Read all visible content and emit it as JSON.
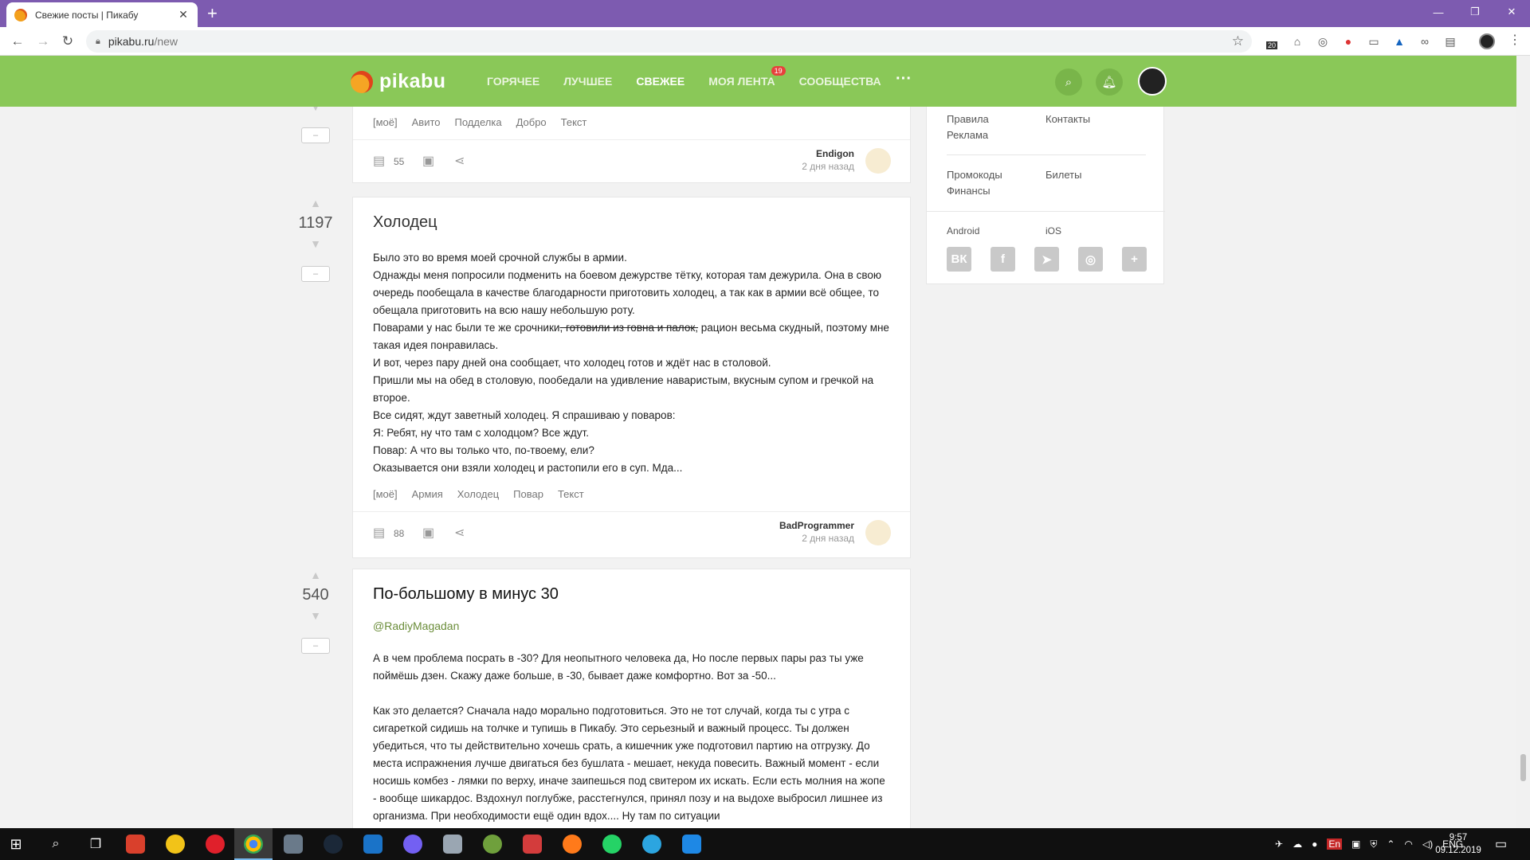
{
  "browser": {
    "tab_title": "Свежие посты | Пикабу",
    "url_host": "pikabu.ru",
    "url_path": "/new",
    "extension_badge": "20"
  },
  "header": {
    "logo": "pikabu",
    "nav": [
      {
        "label": "ГОРЯЧЕЕ",
        "active": false
      },
      {
        "label": "ЛУЧШЕЕ",
        "active": false
      },
      {
        "label": "СВЕЖЕЕ",
        "active": true
      },
      {
        "label": "МОЯ ЛЕНТА",
        "active": false,
        "badge": "19"
      },
      {
        "label": "СООБЩЕСТВА",
        "active": false
      }
    ],
    "more": "···"
  },
  "stories": [
    {
      "tags": [
        "[моё]",
        "Авито",
        "Подделка",
        "Добро",
        "Текст"
      ],
      "comments": "55",
      "author": "Endigon",
      "time": "2 дня назад",
      "minus": "–"
    },
    {
      "rating": "1197",
      "title": "Холодец",
      "lines": [
        "Было это во время моей срочной службы в армии.",
        "Однажды меня попросили подменить на боевом дежурстве тётку, которая там дежурила. Она в свою очередь пообещала в качестве благодарности приготовить холодец, а так как в армии всё общее, то обещала приготовить на всю нашу небольшую роту.",
        "И вот, через пару дней она сообщает, что холодец готов и ждёт нас в столовой.",
        "Пришли мы на обед в столовую, пообедали на удивление наваристым, вкусным супом и гречкой на второе.",
        "Все сидят, ждут заветный холодец. Я спрашиваю у поваров:",
        "Я: Ребят, ну что там с холодцом? Все ждут.",
        "Повар: А что вы только что, по-твоему, ели?",
        "Оказывается они взяли холодец и растопили его в суп. Мда..."
      ],
      "cooks_line": {
        "before": "Поварами у нас были те же срочники",
        "struck": ", готовили из говна и палок,",
        "after": " рацион весьма скудный, поэтому мне такая идея понравилась."
      },
      "tags": [
        "[моё]",
        "Армия",
        "Холодец",
        "Повар",
        "Текст"
      ],
      "comments": "88",
      "author": "BadProgrammer",
      "time": "2 дня назад",
      "minus": "–"
    },
    {
      "rating": "540",
      "title": "По-большому в минус 30",
      "author_link": "@RadiyMagadan",
      "paragraphs": [
        "А в чем проблема посрать в -30? Для неопытного человека да, Но после первых пары раз ты уже поймёшь дзен. Скажу даже больше, в -30, бывает даже комфортно. Вот за -50...",
        "Как это делается? Сначала надо морально подготовиться. Это не тот случай, когда ты с утра с сигареткой сидишь на толчке и тупишь в Пикабу. Это серьезный и важный процесс. Ты должен убедиться, что ты действительно хочешь срать, а кишечник уже подготовил партию на отгрузку. До места испражнения лучше двигаться без бушлата - мешает, некуда повесить. Важный момент - если носишь комбез - лямки по верху, иначе заипешься под свитером их искать. Если есть молния на жопе - вообще шикардос. Вздохнул поглубже, расстегнулся, принял позу и на выдохе выбросил лишнее из организма. При необходимости ещё один вдох.... Ну там по ситуации"
      ],
      "minus": "–"
    }
  ],
  "sidebar": {
    "links_top": [
      "Правила",
      "Реклама",
      "Контакты"
    ],
    "links_mid": [
      "Промокоды",
      "Финансы",
      "Билеты"
    ],
    "apps": [
      "Android",
      "iOS"
    ],
    "social": [
      "ВК",
      "f",
      "➤",
      "◎",
      "+"
    ]
  },
  "taskbar": {
    "tray_lang_small": "En",
    "tray_lang": "ENG",
    "time": "9:57",
    "date": "09.12.2019"
  }
}
